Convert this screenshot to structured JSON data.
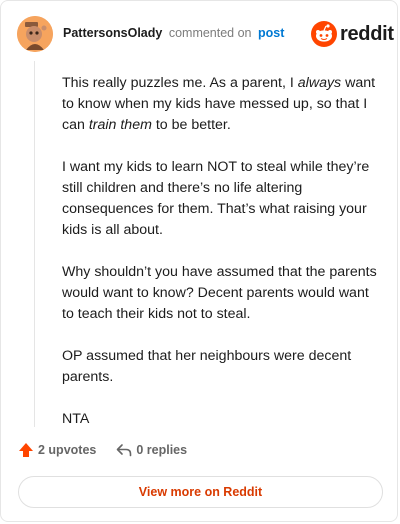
{
  "header": {
    "username": "PattersonsOlady",
    "action_text": "commented on",
    "post_link": "post",
    "brand": "reddit"
  },
  "comment": {
    "p1_a": "This really puzzles me. As a parent, I ",
    "p1_em1": "always",
    "p1_b": " want to know when my kids have messed up, so that I can ",
    "p1_em2": "train them",
    "p1_c": " to be better.",
    "p2": "I want my kids to learn NOT to steal while they’re still children and there’s no life altering consequences for them. That’s what raising your kids is all about.",
    "p3": "Why shouldn’t you have assumed that the parents would want to know? Decent parents would want to teach their kids not to steal.",
    "p4": "OP assumed that her neighbours were decent parents.",
    "p5": "NTA"
  },
  "footer": {
    "upvotes": "2 upvotes",
    "replies": "0 replies",
    "view_more": "View more on Reddit"
  },
  "colors": {
    "upvote": "#ff4500",
    "brand": "#ff4500",
    "link": "#0079d3",
    "view_more": "#d93a00"
  },
  "icons": [
    "avatar-snoo-icon",
    "reddit-logo-icon",
    "upvote-arrow-icon",
    "reply-icon"
  ]
}
